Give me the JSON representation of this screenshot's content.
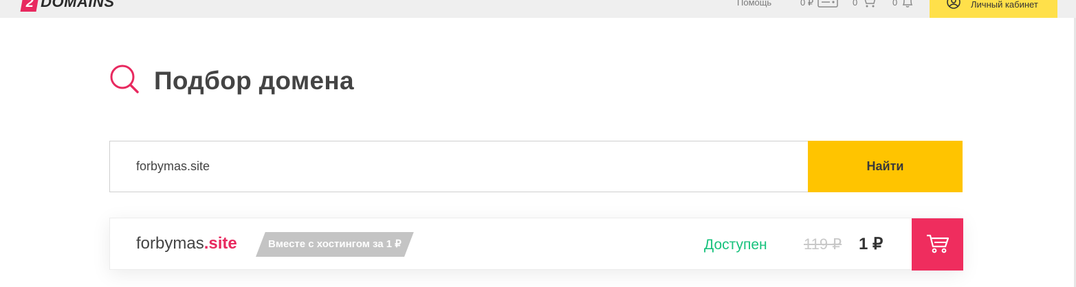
{
  "header": {
    "logo_badge": "2",
    "logo_text": "DOMAINS",
    "help": "Помощь",
    "balance": "0 ₽",
    "cart_count": "0",
    "notifications_count": "0",
    "cabinet_label": "Личный кабинет"
  },
  "page": {
    "title": "Подбор домена"
  },
  "search": {
    "value": "forbymas.site",
    "button_label": "Найти"
  },
  "result": {
    "domain_name": "forbymas",
    "domain_tld": ".site",
    "promo": "Вместе с хостингом за 1 ₽",
    "status": "Доступен",
    "old_price": "119 ₽",
    "new_price": "1 ₽"
  },
  "colors": {
    "brand": "#e8295f",
    "accent_yellow": "#ffc400",
    "available": "#18c27d",
    "cart_button": "#ef2d5e"
  }
}
